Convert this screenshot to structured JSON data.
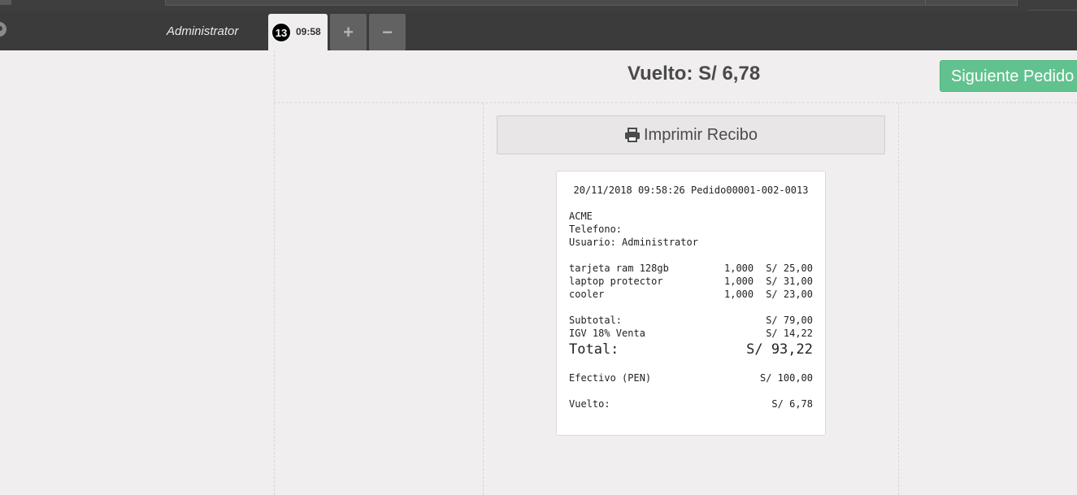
{
  "header": {
    "user_name": "Administrator",
    "active_tab": {
      "number": "13",
      "time": "09:58"
    },
    "add_tab_label": "+",
    "remove_tab_label": "−"
  },
  "main": {
    "change_title": "Vuelto: S/ 6,78",
    "next_order_label": "Siguiente Pedido ›",
    "print_label": "Imprimir Recibo"
  },
  "receipt": {
    "header_line": "20/11/2018 09:58:26 Pedido00001-002-0013",
    "company": "ACME",
    "phone_label": "Telefono:",
    "user_line": "Usuario: Administrator",
    "items": [
      {
        "name": "tarjeta ram 128gb",
        "qty": "1,000",
        "price": "S/ 25,00"
      },
      {
        "name": "laptop protector",
        "qty": "1,000",
        "price": "S/ 31,00"
      },
      {
        "name": "cooler",
        "qty": "1,000",
        "price": "S/ 23,00"
      }
    ],
    "subtotal_label": "Subtotal:",
    "subtotal_value": "S/ 79,00",
    "tax_label": "IGV 18% Venta",
    "tax_value": "S/ 14,22",
    "total_label": "Total:",
    "total_value": "S/ 93,22",
    "payment_label": "Efectivo (PEN)",
    "payment_value": "S/ 100,00",
    "change_label": "Vuelto:",
    "change_value": "S/ 6,78"
  },
  "colors": {
    "navbar": "#3b3b3b",
    "background": "#f0eeee",
    "accent_green": "#62c28f"
  },
  "icons": [
    "circle-icon",
    "plus-icon",
    "minus-icon",
    "print-icon"
  ]
}
